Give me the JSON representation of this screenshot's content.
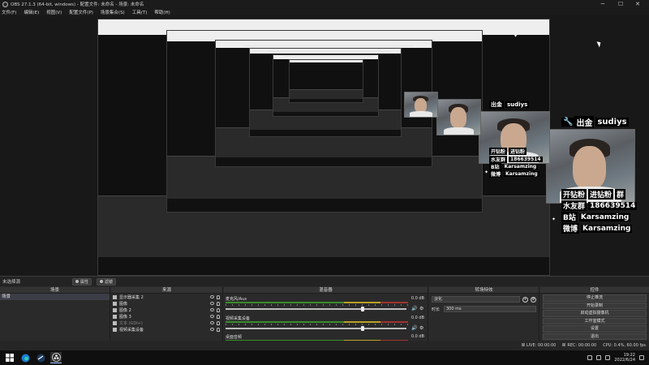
{
  "window": {
    "title": "OBS 27.1.3 (64-bit, windows) - 配置文件: 未命名 - 场景: 未命名",
    "minimize": "─",
    "maximize": "☐",
    "close": "✕"
  },
  "menu": [
    "文件(F)",
    "编辑(E)",
    "视图(V)",
    "配置文件(P)",
    "场景集合(S)",
    "工具(T)",
    "帮助(H)"
  ],
  "overlay": {
    "host_key": "出金",
    "host_name": "sudiys",
    "lines": [
      {
        "key": "开钻粉",
        "value": "进钻粉",
        "extra": "群"
      },
      {
        "key": "水友群",
        "value": "186639514"
      },
      {
        "key": "B站",
        "value": "Karsamzing"
      },
      {
        "key": "微博",
        "value": "Karsamzing"
      }
    ]
  },
  "scene_strip": {
    "scene_label": "未选择源",
    "properties_label": "属性",
    "filters_label": "滤镜"
  },
  "scenes": {
    "header": "场景",
    "items": [
      "场景"
    ]
  },
  "sources": {
    "header": "来源",
    "items": [
      {
        "label": "显示器采集 2",
        "dim": false
      },
      {
        "label": "图像",
        "dim": false
      },
      {
        "label": "图像 2",
        "dim": false
      },
      {
        "label": "图像 3",
        "dim": false
      },
      {
        "label": "文本 (GDI+)",
        "dim": true
      },
      {
        "label": "视频采集设备",
        "dim": false
      }
    ]
  },
  "mixer": {
    "header": "混音器",
    "channels": [
      {
        "name": "麦克风/Aux",
        "db": "0.0 dB",
        "level": 0.76
      },
      {
        "name": "视频采集设备",
        "db": "0.0 dB",
        "level": 0.76
      },
      {
        "name": "桌面音频",
        "db": "0.0 dB",
        "level": 0.76
      }
    ]
  },
  "transitions": {
    "header": "转场特效",
    "type": "淡化",
    "duration_label": "时长",
    "duration_value": "300 ms"
  },
  "controls": {
    "header": "控件",
    "buttons": [
      "停止推流",
      "开始录制",
      "启动虚拟摄像机",
      "工作室模式",
      "设置",
      "退出"
    ]
  },
  "statusbar": {
    "live": "LIVE: 00:00:00",
    "rec": "REC: 00:00:00",
    "cpu": "CPU: 0.4%, 60.00 fps"
  },
  "taskbar": {
    "time": "19:22",
    "date": "2022/6/24"
  }
}
